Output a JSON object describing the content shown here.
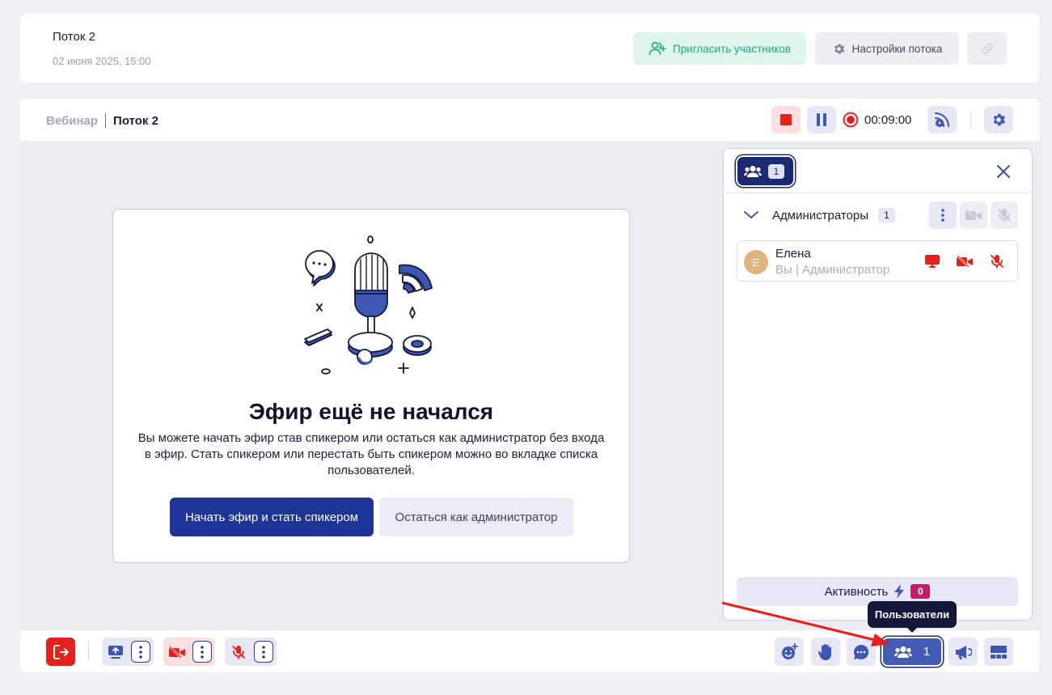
{
  "stream": {
    "title": "Поток 2",
    "date": "02 июня 2025, 15:00",
    "invite_label": "Пригласить участников",
    "settings_label": "Настройки потока"
  },
  "breadcrumb": {
    "parent": "Вебинар",
    "current": "Поток 2"
  },
  "recording": {
    "timer": "00:09:00"
  },
  "center": {
    "title": "Эфир ещё не начался",
    "description": "Вы можете начать эфир став спикером или остаться как администратор без входа в эфир. Стать спикером или перестать быть спикером можно во вкладке списка пользователей.",
    "start_label": "Начать эфир и стать спикером",
    "stay_label": "Остаться как администратор"
  },
  "panel": {
    "tab_count": "1",
    "group_label": "Администраторы",
    "group_count": "1",
    "user": {
      "initial": "Е",
      "name": "Елена",
      "role": "Вы | Администратор"
    },
    "activity_label": "Активность",
    "activity_count": "0"
  },
  "bottom": {
    "users_count": "1"
  },
  "tooltip": {
    "text": "Пользователи"
  },
  "colors": {
    "accent_dark": "#1c3597",
    "danger": "#e3231a",
    "invite_green": "#1ea981",
    "activity_badge": "#c41d68"
  }
}
